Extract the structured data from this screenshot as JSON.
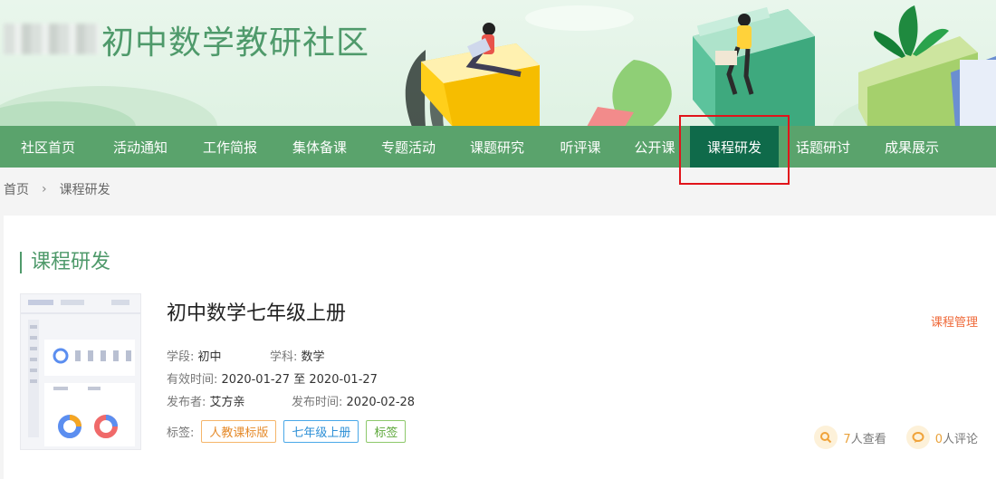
{
  "site": {
    "title": "初中数学教研社区"
  },
  "nav": {
    "items": [
      {
        "label": "社区首页",
        "active": false
      },
      {
        "label": "活动通知",
        "active": false
      },
      {
        "label": "工作简报",
        "active": false
      },
      {
        "label": "集体备课",
        "active": false
      },
      {
        "label": "专题活动",
        "active": false
      },
      {
        "label": "课题研究",
        "active": false
      },
      {
        "label": "听评课",
        "active": false
      },
      {
        "label": "公开课",
        "active": false
      },
      {
        "label": "课程研发",
        "active": true
      },
      {
        "label": "话题研讨",
        "active": false
      },
      {
        "label": "成果展示",
        "active": false
      }
    ]
  },
  "breadcrumb": {
    "home": "首页",
    "sep": "›",
    "current": "课程研发"
  },
  "section": {
    "title": "课程研发"
  },
  "course": {
    "title": "初中数学七年级上册",
    "stage_label": "学段:",
    "stage": "初中",
    "subject_label": "学科:",
    "subject": "数学",
    "valid_label": "有效时间:",
    "valid_from": "2020-01-27",
    "valid_to_word": "至",
    "valid_to": "2020-01-27",
    "publisher_label": "发布者:",
    "publisher": "艾方亲",
    "pubdate_label": "发布时间:",
    "pubdate": "2020-02-28",
    "tags_label": "标签:",
    "tags": [
      "人教课标版",
      "七年级上册",
      "标签"
    ],
    "manage_label": "课程管理",
    "views": "7",
    "views_suffix": "人查看",
    "comments": "0",
    "comments_suffix": "人评论"
  },
  "colors": {
    "nav_bg": "#5aa36c",
    "nav_active": "#0f6a4a",
    "accent_green": "#4f9a6b",
    "manage_orange": "#ef6a3a"
  },
  "icons": {
    "views": "search-icon",
    "comments": "comment-icon",
    "breadcrumb_sep": "chevron-right-icon"
  }
}
